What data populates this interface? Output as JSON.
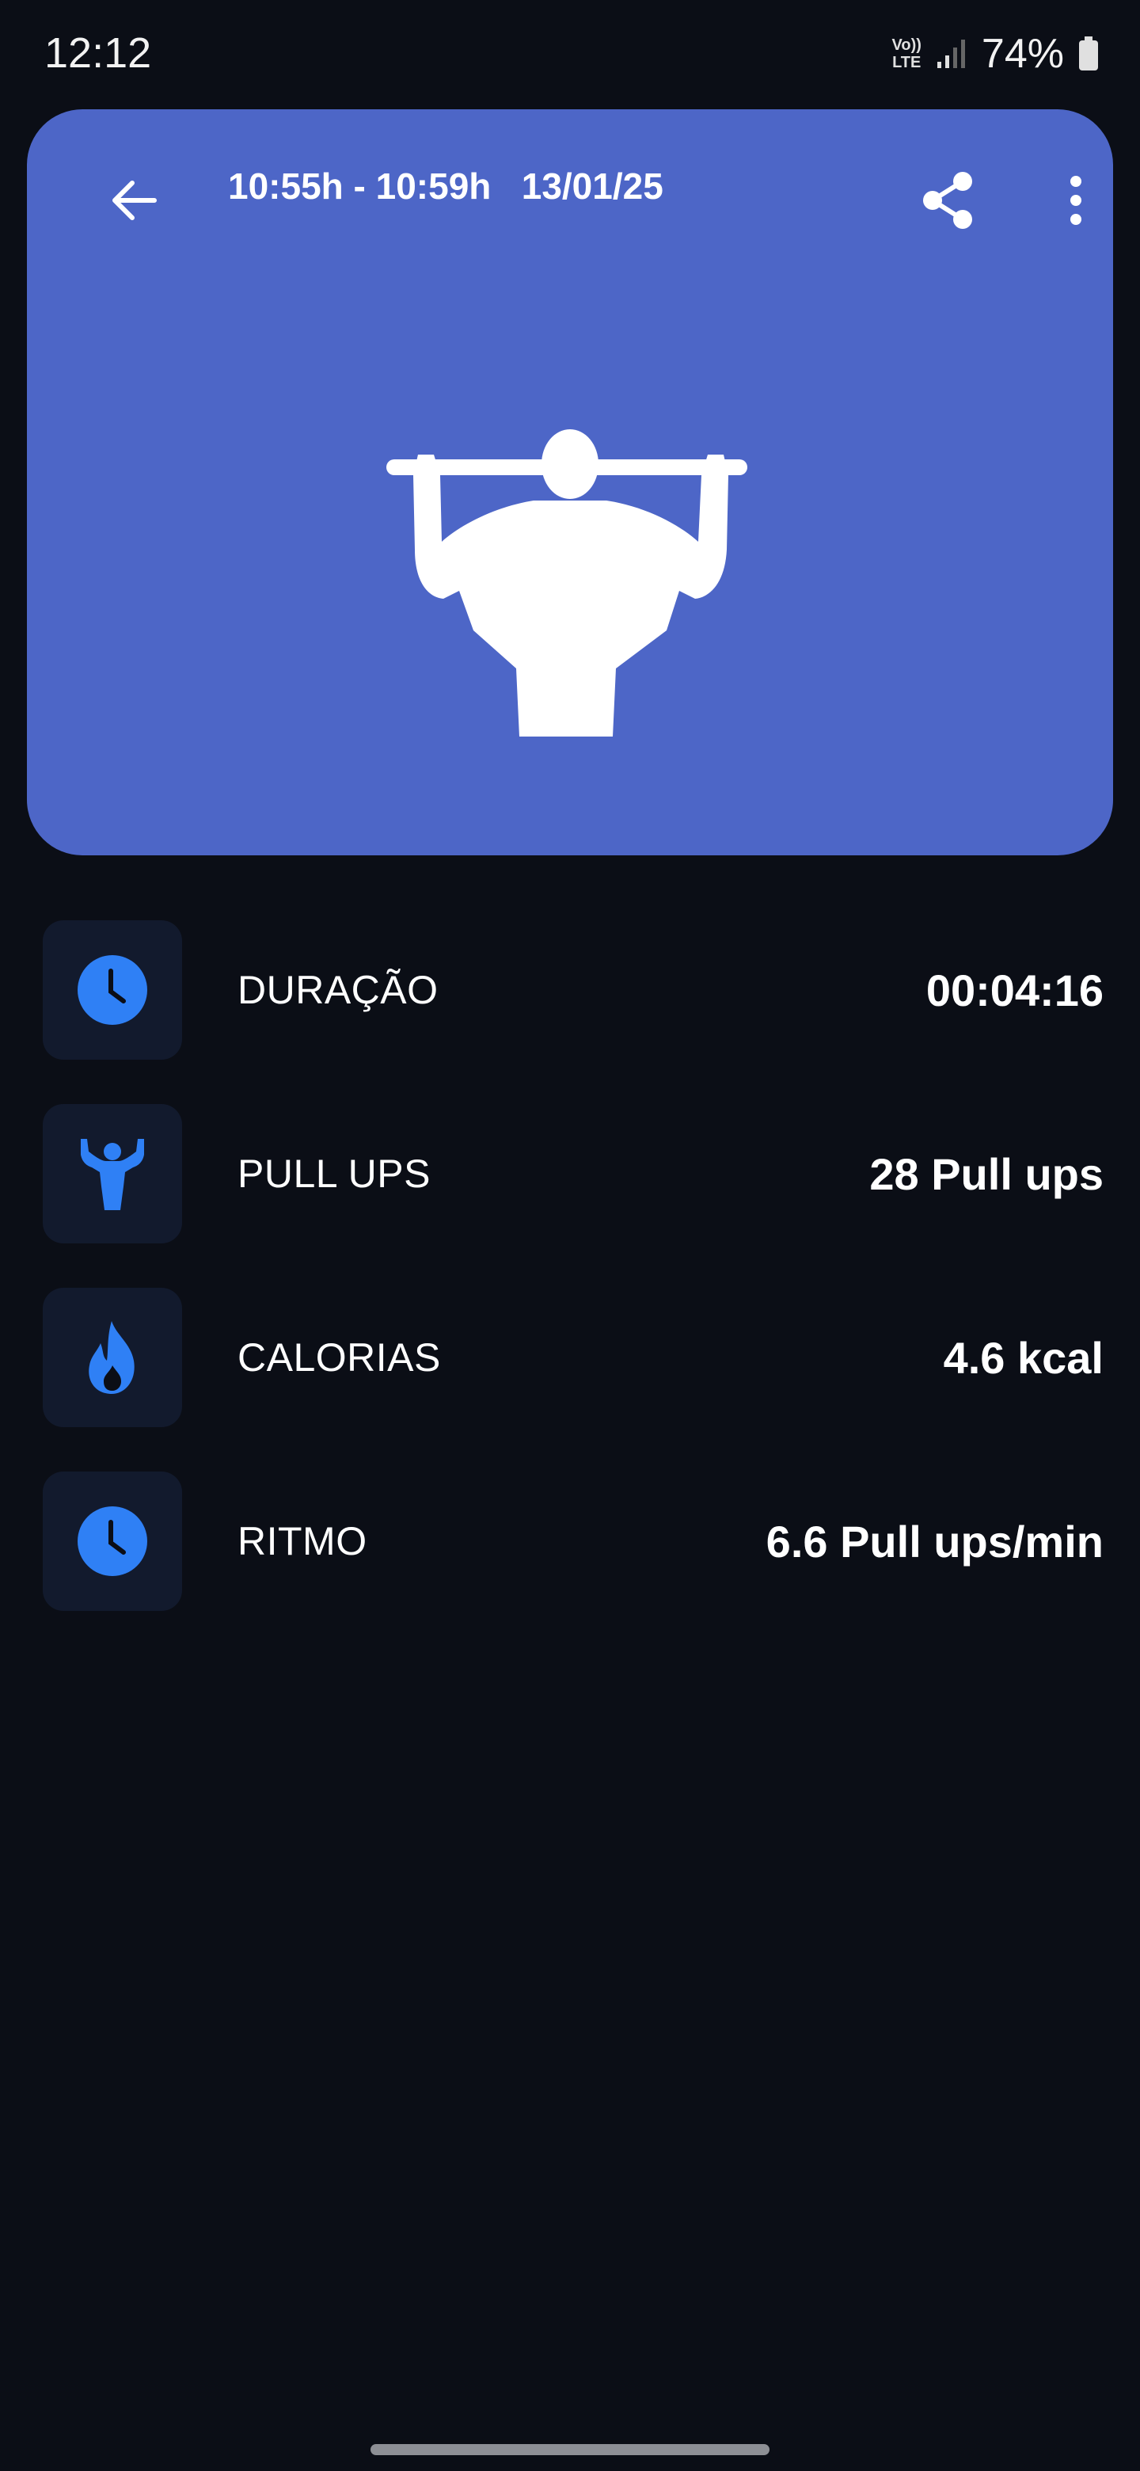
{
  "status_bar": {
    "time": "12:12",
    "network_top": "Vo))",
    "network_bottom": "LTE",
    "battery": "74%"
  },
  "header": {
    "time_range": "10:55h - 10:59h",
    "date": "13/01/25"
  },
  "stats": [
    {
      "icon": "clock-icon",
      "label": "DURAÇÃO",
      "value": "00:04:16"
    },
    {
      "icon": "muscle-man-icon",
      "label": "PULL UPS",
      "value": "28 Pull ups"
    },
    {
      "icon": "flame-icon",
      "label": "CALORIAS",
      "value": "4.6 kcal"
    },
    {
      "icon": "clock-icon",
      "label": "RITMO",
      "value": "6.6 Pull ups/min"
    }
  ],
  "colors": {
    "background": "#0b0e16",
    "hero": "#4d66c7",
    "accent": "#2f80f5",
    "tile": "#121a2d"
  }
}
